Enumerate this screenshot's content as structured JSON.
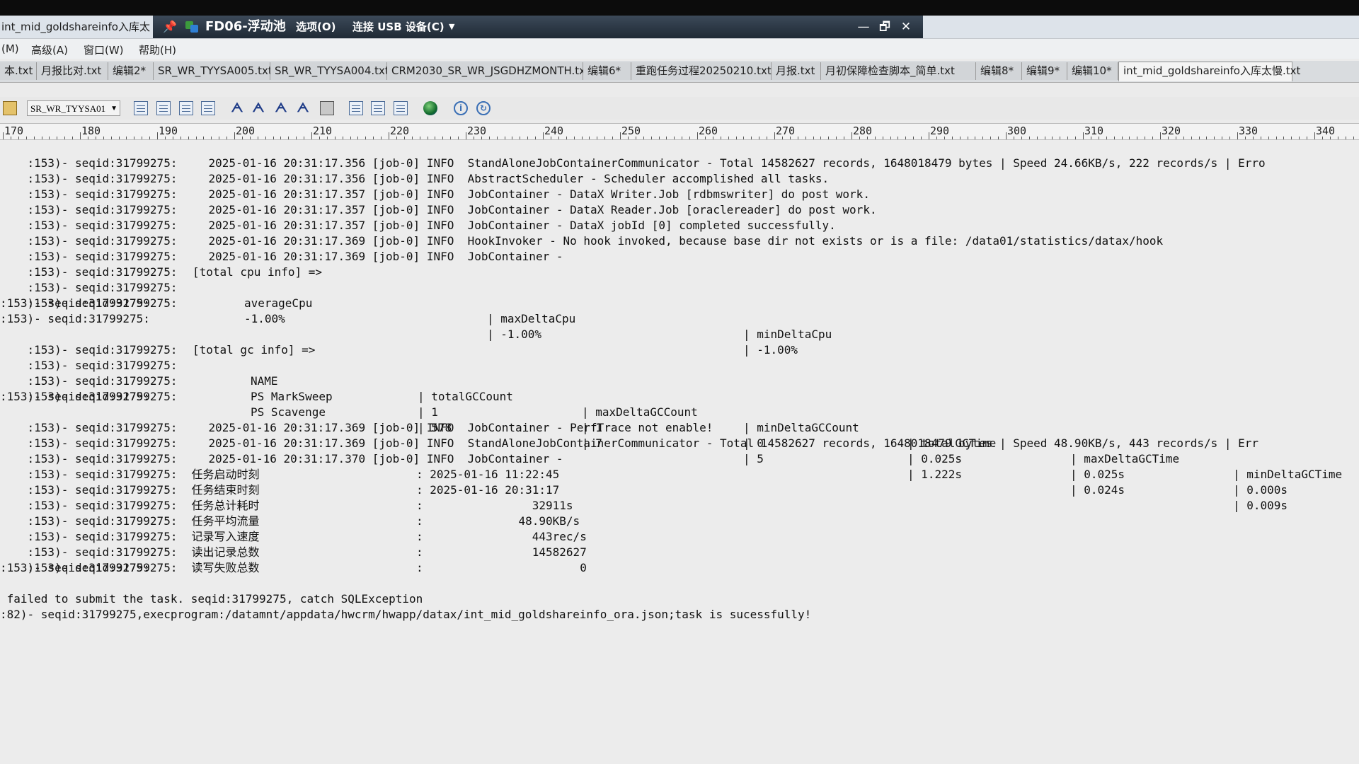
{
  "window": {
    "app_title": "int_mid_goldshareinfo入库太",
    "remote_bar": {
      "name": "FD06-浮动池",
      "options": "选项(O)",
      "usb": "连接 USB 设备(C)",
      "minimize_glyph": "—",
      "restore_glyph": "🗗",
      "close_glyph": "✕"
    }
  },
  "menu": [
    "(M)",
    "高级(A)",
    "窗口(W)",
    "帮助(H)"
  ],
  "tabs": [
    {
      "label": "本.txt"
    },
    {
      "label": "月报比对.txt"
    },
    {
      "label": "编辑2*"
    },
    {
      "label": "SR_WR_TYYSA005.txt"
    },
    {
      "label": "SR_WR_TYYSA004.txt"
    },
    {
      "label": "CRM2030_SR_WR_JSGDHZMONTH.txt"
    },
    {
      "label": "编辑6*"
    },
    {
      "label": "重跑任务过程20250210.txt"
    },
    {
      "label": "月报.txt"
    },
    {
      "label": "月初保障检查脚本_简单.txt"
    },
    {
      "label": "编辑8*"
    },
    {
      "label": "编辑9*"
    },
    {
      "label": "编辑10*"
    },
    {
      "label": "int_mid_goldshareinfo入库太慢.txt",
      "active": true
    }
  ],
  "toolbar": {
    "combo_value": "SR_WR_TYYSA01",
    "icons": [
      "folder-icon",
      "align-left-icon",
      "align-center-icon",
      "align-right-icon",
      "justify-icon",
      "find-icon",
      "find-next-icon",
      "replace-icon",
      "find-in-files-icon",
      "print-icon",
      "split-horizontal-icon",
      "split-vertical-icon",
      "window-icon",
      "globe-icon",
      "info-icon",
      "refresh-icon"
    ]
  },
  "ruler": [
    "170",
    "180",
    "190",
    "200",
    "210",
    "220",
    "230",
    "240",
    "250",
    "260",
    "270",
    "280",
    "290",
    "300",
    "310",
    "320",
    "330",
    "340"
  ],
  "log": {
    "prefix": ":153)- seqid:31799275:",
    "ts1": "2025-01-16 20:31:17.356",
    "ts2": "2025-01-16 20:31:17.357",
    "ts3": "2025-01-16 20:31:17.369",
    "ts4": "2025-01-16 20:31:17.370",
    "job": "[job-0]",
    "info": "INFO",
    "msg1": "StandAloneJobContainerCommunicator - Total 14582627 records, 1648018479 bytes | Speed 24.66KB/s, 222 records/s | Erro",
    "msg2": "AbstractScheduler - Scheduler accomplished all tasks.",
    "msg3": "JobContainer - DataX Writer.Job [rdbmswriter] do post work.",
    "msg4": "JobContainer - DataX Reader.Job [oraclereader] do post work.",
    "msg5": "JobContainer - DataX jobId [0] completed successfully.",
    "msg6": "HookInvoker - No hook invoked, because base dir not exists or is a file: /data01/statistics/datax/hook",
    "msg7": "JobContainer -",
    "cpu_header": "[total cpu info] =>",
    "cpu_cols": [
      "averageCpu",
      "| maxDeltaCpu",
      "| minDeltaCpu"
    ],
    "cpu_vals": [
      "-1.00%",
      "| -1.00%",
      "| -1.00%"
    ],
    "gc_header": "[total gc info] =>",
    "gc_cols": [
      "NAME",
      "| totalGCCount",
      "| maxDeltaGCCount",
      "| minDeltaGCCount",
      "| totalGCTime",
      "| maxDeltaGCTime",
      "| minDeltaGCTime"
    ],
    "gc_rows": [
      [
        "PS MarkSweep",
        "| 1",
        "| 1",
        "| 0",
        "| 0.025s",
        "| 0.025s",
        "| 0.000s"
      ],
      [
        "PS Scavenge",
        "| 578",
        "| 7",
        "| 5",
        "| 1.222s",
        "| 0.024s",
        "| 0.009s"
      ]
    ],
    "msg8": "JobContainer - PerfTrace not enable!",
    "msg9": "StandAloneJobContainerCommunicator - Total 14582627 records, 1648018479 bytes | Speed 48.90KB/s, 443 records/s | Err",
    "summary": [
      {
        "label": "任务启动时刻",
        "value": ": 2025-01-16 11:22:45"
      },
      {
        "label": "任务结束时刻",
        "value": ": 2025-01-16 20:31:17"
      },
      {
        "label": "任务总计耗时",
        "value": ":                32911s"
      },
      {
        "label": "任务平均流量",
        "value": ":              48.90KB/s"
      },
      {
        "label": "记录写入速度",
        "value": ":                443rec/s"
      },
      {
        "label": "读出记录总数",
        "value": ":                14582627"
      },
      {
        "label": "读写失败总数",
        "value": ":                       0"
      }
    ],
    "fail_line": " failed to submit the task. seqid:31799275, catch SQLException",
    "exec_line": ":82)- seqid:31799275,execprogram:/datamnt/appdata/hwcrm/hwapp/datax/int_mid_goldshareinfo_ora.json;task is sucessfully!"
  }
}
